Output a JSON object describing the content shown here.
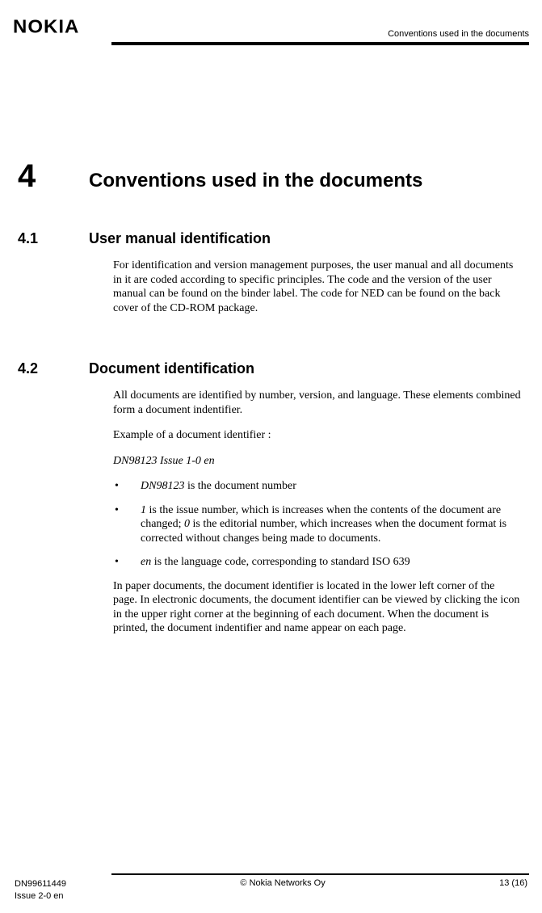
{
  "header": {
    "logo": "NOKIA",
    "running_title": "Conventions used in the documents"
  },
  "chapter": {
    "number": "4",
    "title": "Conventions used in the documents"
  },
  "section1": {
    "number": "4.1",
    "title": "User manual identification",
    "para": "For identification and version management purposes, the user manual and all documents in it are coded according to specific principles. The code and the version of the user manual can be found on the binder label. The code for NED can be found on the back cover of the CD-ROM package."
  },
  "section2": {
    "number": "4.2",
    "title": "Document identification",
    "para_intro": "All documents are identified by number, version, and language. These elements combined form a document indentifier.",
    "para_example_label": "Example of a document identifier :",
    "example_id": "DN98123 Issue 1-0 en",
    "bullets": {
      "b1_em": "DN98123",
      "b1_rest": " is the document number",
      "b2_em1": "1",
      "b2_mid": " is the issue number, which is increases when the contents of the document are changed; ",
      "b2_em2": "0",
      "b2_rest": " is the editorial number, which increases when the document format is corrected without changes being made to documents.",
      "b3_em": "en",
      "b3_rest": " is the language code, corresponding to standard ISO 639"
    },
    "para_outro": "In paper documents, the document identifier is located in the lower left corner of the page. In electronic documents, the document identifier can be viewed by clicking the icon in the upper right corner at the beginning of each document. When the document is printed, the document indentifier and name appear on each page."
  },
  "footer": {
    "doc_code": "DN99611449",
    "issue": "Issue 2-0 en",
    "copyright": "© Nokia Networks Oy",
    "page": "13 (16)"
  }
}
